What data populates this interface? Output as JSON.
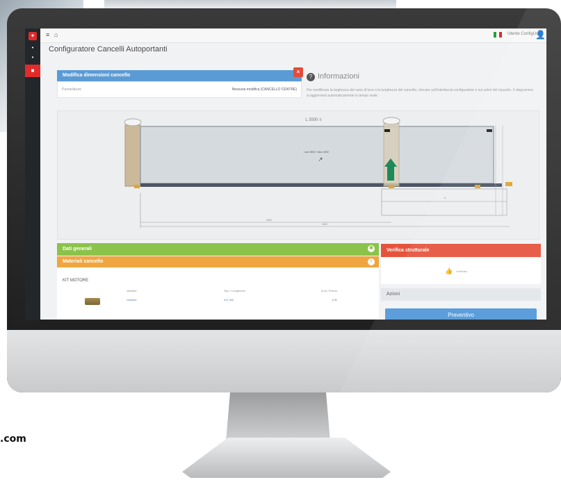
{
  "site": {
    "domain_fragment": ".com"
  },
  "app": {
    "title": "Configuratore Cancelli Autoportanti"
  },
  "topbar": {
    "flag_country": "italy",
    "user_label": "Utente ConfigUser"
  },
  "sidebar": {
    "items": [
      {
        "icon": "logo-icon"
      },
      {
        "icon": "dot-icon"
      },
      {
        "icon": "dot-icon"
      },
      {
        "icon": "gate-icon",
        "active": true
      }
    ]
  },
  "dimensions_panel": {
    "header": "Modifica dimensioni cancello",
    "field_label": "Pannellature",
    "field_value": "Nessuna modifica (CANCELLO CENTRE)"
  },
  "info": {
    "title": "Informazioni",
    "text": "Per modificare la larghezza del vano di luce o la lunghezza del cancello, cliccare sull'interfaccia configuratore o sui valori del riquadro. Il diagramma si aggiornerà automaticamente in tempo reale."
  },
  "drawing": {
    "top_dimension": "L 3500 ≡",
    "center_label": "Luce 3500 / Vano 4000",
    "bottom_labels": [
      "A",
      "3500",
      "4000"
    ]
  },
  "general_panel": {
    "header": "Dati generali"
  },
  "materials_panel": {
    "header": "Materiali cancello"
  },
  "structural_panel": {
    "header": "Verifica strutturale",
    "status_text": "Verificato"
  },
  "actions": {
    "header": "Azioni",
    "button": "Preventivo"
  },
  "materials_list": {
    "kit_title": "KIT MOTORE",
    "columns": [
      "Variante",
      "Tipo / Lunghezza",
      "Q.tà / Prezzo"
    ],
    "rows": [
      {
        "variante": "Variante",
        "tipo": "A/V 400",
        "qta": "1,00"
      }
    ]
  },
  "colors": {
    "accent_red": "#e22b2b",
    "blue": "#5b9bd5",
    "green": "#8bc34a",
    "orange": "#f0a640",
    "verify_red": "#e5533c",
    "action_blue": "#4f97d8"
  }
}
